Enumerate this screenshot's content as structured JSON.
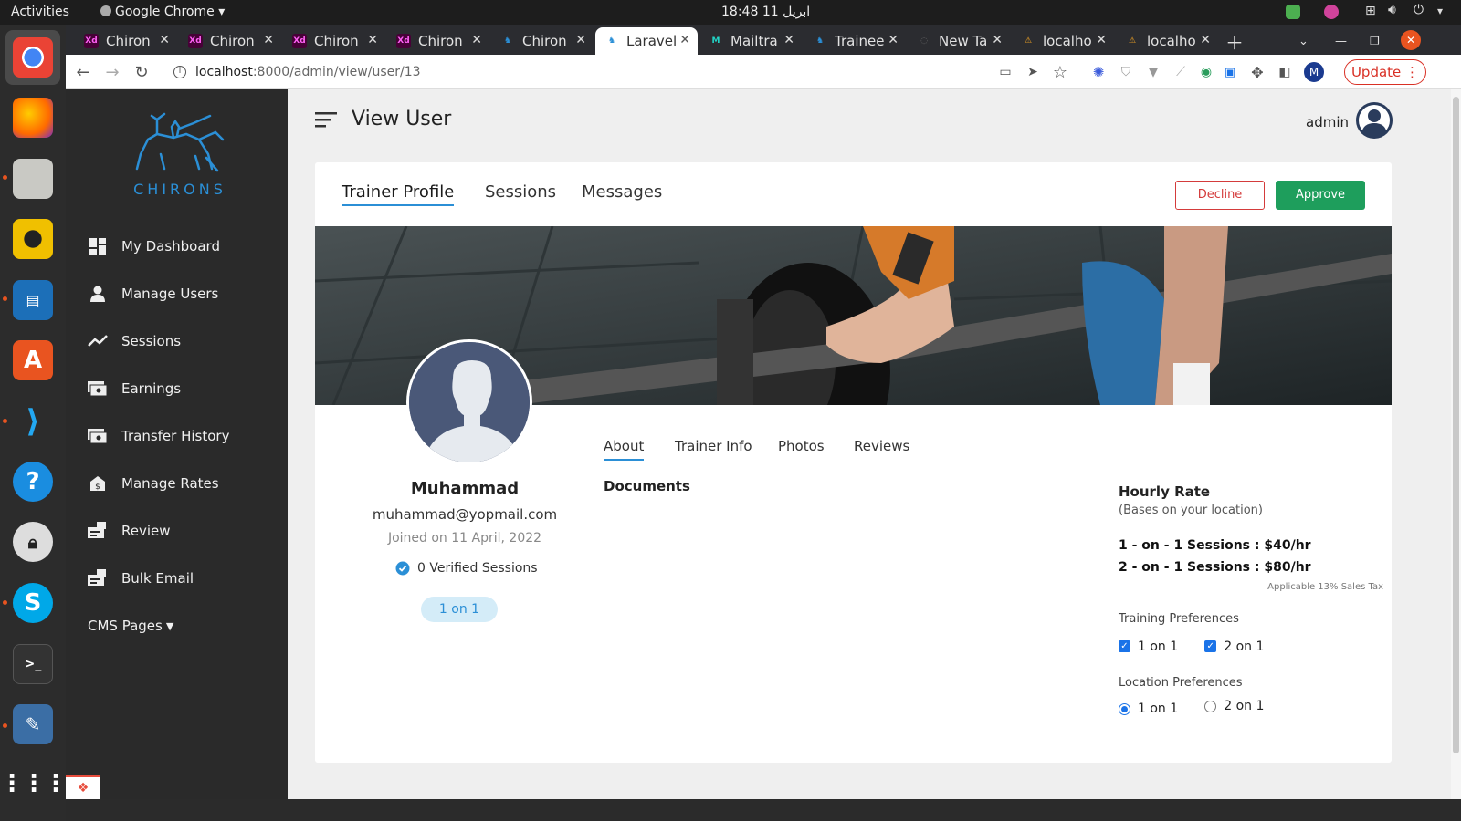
{
  "os": {
    "activities": "Activities",
    "app_name": "Google Chrome",
    "clock": "18:48",
    "date": "ابريل 11"
  },
  "browser": {
    "tabs": [
      {
        "label": "Chiron",
        "favicon": "Xd"
      },
      {
        "label": "Chiron",
        "favicon": "Xd"
      },
      {
        "label": "Chiron",
        "favicon": "Xd"
      },
      {
        "label": "Chiron",
        "favicon": "Xd"
      },
      {
        "label": "Chiron",
        "favicon": "chiron"
      },
      {
        "label": "Laravel",
        "favicon": "chiron",
        "active": true
      },
      {
        "label": "Mailtra",
        "favicon": "mailtrap"
      },
      {
        "label": "Trainee",
        "favicon": "chiron"
      },
      {
        "label": "New Ta",
        "favicon": "new"
      },
      {
        "label": "localho",
        "favicon": "warning"
      },
      {
        "label": "localho",
        "favicon": "warning"
      }
    ],
    "url_host": "localhost",
    "url_path": ":8000/admin/view/user/13",
    "update_label": "Update",
    "profile_initial": "M"
  },
  "sidebar": {
    "brand": "CHIRONS",
    "items": [
      {
        "label": "My Dashboard",
        "icon": "dashboard-icon"
      },
      {
        "label": "Manage Users",
        "icon": "user-icon"
      },
      {
        "label": "Sessions",
        "icon": "trend-icon"
      },
      {
        "label": "Earnings",
        "icon": "money-icon"
      },
      {
        "label": "Transfer History",
        "icon": "money-icon"
      },
      {
        "label": "Manage Rates",
        "icon": "rates-icon"
      },
      {
        "label": "Review",
        "icon": "review-icon"
      },
      {
        "label": "Bulk Email",
        "icon": "email-icon"
      }
    ],
    "cms": "CMS Pages"
  },
  "header": {
    "title": "View User",
    "user": "admin"
  },
  "profile_tabs": [
    "Trainer Profile",
    "Sessions",
    "Messages"
  ],
  "actions": {
    "decline": "Decline",
    "approve": "Approve"
  },
  "user": {
    "name": "Muhammad",
    "email": "muhammad@yopmail.com",
    "joined": "Joined on 11 April, 2022",
    "verified": "0 Verified Sessions",
    "badge": "1 on 1"
  },
  "sub_tabs": [
    "About",
    "Trainer Info",
    "Photos",
    "Reviews"
  ],
  "documents_label": "Documents",
  "rate": {
    "title": "Hourly Rate",
    "subtitle": "(Bases on your location)",
    "line1": "1 - on - 1 Sessions : $40/hr",
    "line2": "2 - on - 1 Sessions : $80/hr",
    "tax": "Applicable 13% Sales Tax",
    "training_title": "Training Preferences",
    "training_opt1": "1 on 1",
    "training_opt2": "2 on 1",
    "location_title": "Location Preferences",
    "location_opt1": "1 on 1",
    "location_opt2": "2 on 1"
  },
  "colors": {
    "approve": "#1e9e5c",
    "decline": "#d43b3b",
    "accent": "#2b8fd6"
  }
}
